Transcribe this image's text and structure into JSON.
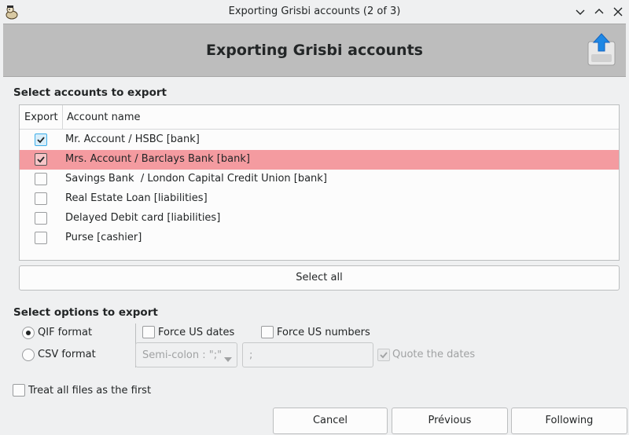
{
  "window": {
    "title": "Exporting Grisbi accounts (2 of 3)",
    "app_icon": "grisbi-icon",
    "controls": [
      "minimize-icon",
      "maximize-icon",
      "close-icon"
    ]
  },
  "header": {
    "title": "Exporting Grisbi accounts",
    "icon": "export-upload-icon"
  },
  "accounts_section": {
    "label": "Select accounts to export",
    "columns": [
      "Export",
      "Account name"
    ],
    "rows": [
      {
        "name": "Mr. Account / HSBC [bank]",
        "checked": true,
        "selected": false
      },
      {
        "name": "Mrs. Account / Barclays Bank [bank]",
        "checked": true,
        "selected": true
      },
      {
        "name": "Savings Bank  / London Capital Credit Union [bank]",
        "checked": false,
        "selected": false
      },
      {
        "name": "Real Estate Loan [liabilities]",
        "checked": false,
        "selected": false
      },
      {
        "name": "Delayed Debit card [liabilities]",
        "checked": false,
        "selected": false
      },
      {
        "name": "Purse [cashier]",
        "checked": false,
        "selected": false
      }
    ],
    "select_all_label": "Select all"
  },
  "options_section": {
    "label": "Select options to export",
    "qif_label": "QIF format",
    "csv_label": "CSV format",
    "selected_format": "QIF format",
    "force_us_dates_label": "Force US dates",
    "force_us_numbers_label": "Force US numbers",
    "separator_value": "Semi-colon : \";\"",
    "separator_text": ";",
    "quote_dates_label": "Quote the dates",
    "quote_dates_checked": true
  },
  "treat_all_label": "Treat all files as the first",
  "buttons": {
    "cancel": "Cancel",
    "previous": "Prévious",
    "following": "Following"
  },
  "colors": {
    "selection": "#f49ba0",
    "header_bg": "#bdbdbd",
    "accent": "#3daee9"
  }
}
